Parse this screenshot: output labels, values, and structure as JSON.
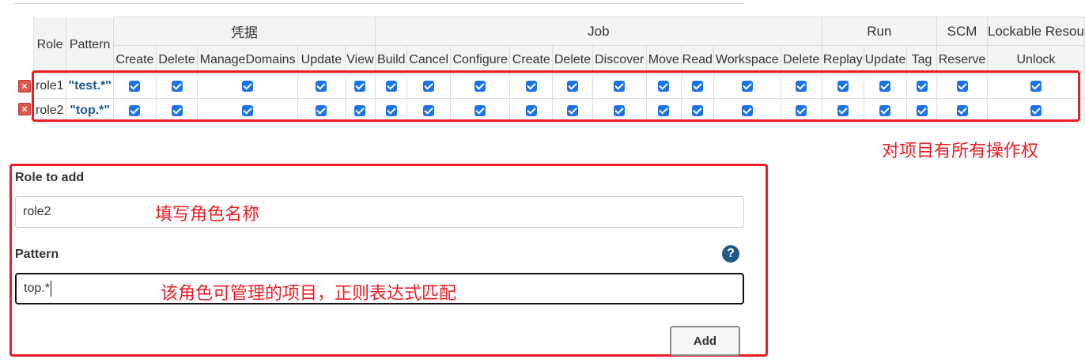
{
  "table": {
    "col_role": "Role",
    "col_pattern": "Pattern",
    "groups": [
      {
        "name": "凭据",
        "span": 5
      },
      {
        "name": "Job",
        "span": 10
      },
      {
        "name": "Run",
        "span": 3
      },
      {
        "name": "SCM",
        "span": 1
      },
      {
        "name": "Lockable Resou",
        "span": 2
      }
    ],
    "permissions": [
      "Create",
      "Delete",
      "ManageDomains",
      "Update",
      "View",
      "Build",
      "Cancel",
      "Configure",
      "Create",
      "Delete",
      "Discover",
      "Move",
      "Read",
      "Workspace",
      "Delete",
      "Replay",
      "Update",
      "Tag",
      "Reserve",
      "Unlock"
    ],
    "rows": [
      {
        "role": "role1",
        "pattern": "\"test.*\"",
        "checked": [
          true,
          true,
          true,
          true,
          true,
          true,
          true,
          true,
          true,
          true,
          true,
          true,
          true,
          true,
          true,
          true,
          true,
          true,
          true,
          true
        ]
      },
      {
        "role": "role2",
        "pattern": "\"top.*\"",
        "checked": [
          true,
          true,
          true,
          true,
          true,
          true,
          true,
          true,
          true,
          true,
          true,
          true,
          true,
          true,
          true,
          true,
          true,
          true,
          true,
          true
        ]
      }
    ],
    "delete_icon": "delete-x-icon"
  },
  "form": {
    "role_label": "Role to add",
    "role_value": "role2",
    "pattern_label": "Pattern",
    "pattern_value": "top.*",
    "help_glyph": "?",
    "add_label": "Add"
  },
  "annotations": {
    "table_note": "对项目有所有操作权",
    "role_note": "填写角色名称",
    "pattern_note": "该角色可管理的项目，正则表达式匹配"
  },
  "colors": {
    "annotation": "#ee1c24",
    "checkbox": "#1a73e8",
    "pattern_text": "#1d5a89",
    "header_bg": "#f3f4f5"
  }
}
